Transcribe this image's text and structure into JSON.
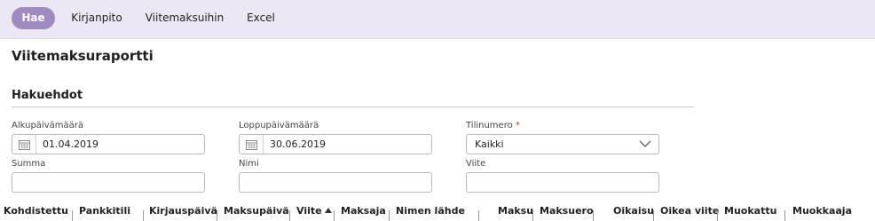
{
  "toolbar": {
    "search_label": "Hae",
    "accounting_label": "Kirjanpito",
    "to_payments_label": "Viitemaksuihin",
    "excel_label": "Excel"
  },
  "page": {
    "title": "Viitemaksuraportti",
    "section_title": "Hakuehdot"
  },
  "filters": {
    "start_date": {
      "label": "Alkupäivämäärä",
      "value": "01.04.2019"
    },
    "end_date": {
      "label": "Loppupäivämäärä",
      "value": "30.06.2019"
    },
    "account_number": {
      "label": "Tilinumero",
      "required_mark": "*",
      "selected": "Kaikki"
    },
    "amount": {
      "label": "Summa",
      "value": ""
    },
    "name": {
      "label": "Nimi",
      "value": ""
    },
    "reference": {
      "label": "Viite",
      "value": ""
    }
  },
  "grid": {
    "columns": [
      "Kohdistettu",
      "Pankkitili",
      "Kirjauspäivä",
      "Maksupäivä",
      "Viite",
      "Maksaja",
      "Nimen lähde",
      "Maksu",
      "Maksuero",
      "Oikaisu",
      "Oikea viite",
      "Muokattu",
      "Muokkaaja"
    ],
    "sort_column": "Viite",
    "sort_direction": "ascending"
  },
  "colors": {
    "toolbar_bg": "#ede6f3",
    "active_button": "#a08bc0",
    "required": "#c0392b"
  }
}
